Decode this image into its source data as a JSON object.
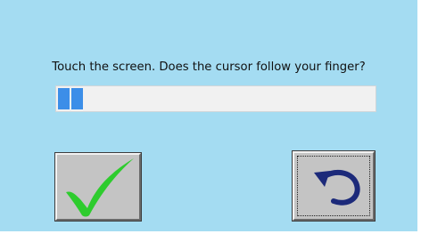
{
  "dialog": {
    "prompt": "Touch the screen. Does the cursor follow your finger?",
    "background_color": "#a4dcf2"
  },
  "progress": {
    "filled_blocks": 2,
    "fraction": 0.08,
    "fill_color": "#3c8ee8"
  },
  "buttons": {
    "confirm": {
      "icon": "checkmark-icon",
      "icon_color": "#2ecc2e"
    },
    "undo": {
      "icon": "undo-arrow-icon",
      "icon_color": "#1c2a7a",
      "focused": true
    }
  }
}
